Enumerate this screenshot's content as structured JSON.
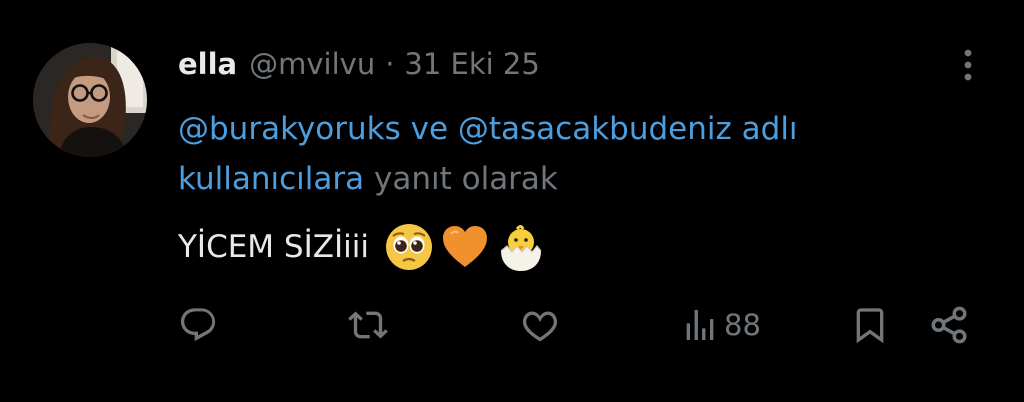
{
  "tweet": {
    "display_name": "ella",
    "handle": "@mvilvu",
    "separator": "·",
    "date": "31 Eki 25",
    "reply_to": {
      "mention_1": "@burakyoruks",
      "connector": "ve",
      "mention_2": "@tasacakbudeniz",
      "mention_suffix": "adlı",
      "mention_tail": "kullanıcılara",
      "trailing_text": "yanıt olarak"
    },
    "text": "YİCEM SİZİiii",
    "emojis": [
      "pleading-face-emoji",
      "orange-heart-emoji",
      "hatching-chick-emoji"
    ],
    "views": "88"
  },
  "icons": {
    "more": "more-vertical-icon",
    "reply": "reply-icon",
    "retweet": "retweet-icon",
    "like": "like-icon",
    "views": "views-icon",
    "bookmark": "bookmark-icon",
    "share": "share-icon"
  },
  "colors": {
    "background": "#000000",
    "primary_text": "#e7e9ea",
    "secondary_text": "#71767b",
    "link": "#4e9ede"
  }
}
